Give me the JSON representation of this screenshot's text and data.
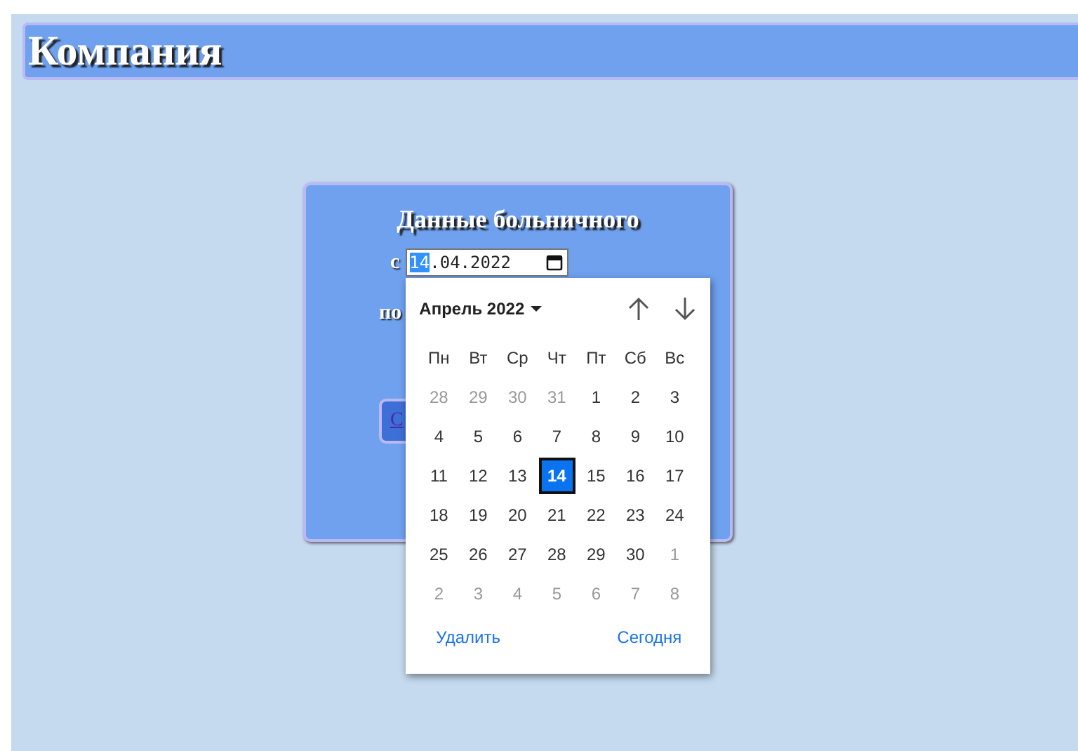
{
  "header": {
    "title": "Компания"
  },
  "form": {
    "title": "Данные больничного",
    "from_label": "с",
    "to_label": "по",
    "from_value": [
      {
        "text": "14",
        "selected": true
      },
      {
        "text": ".04.2022",
        "selected": false
      }
    ],
    "button": "С"
  },
  "datepicker": {
    "month": "Апрель 2022",
    "weekdays": [
      "Пн",
      "Вт",
      "Ср",
      "Чт",
      "Пт",
      "Сб",
      "Вс"
    ],
    "days": [
      {
        "text": "28",
        "muted": true,
        "selected": false
      },
      {
        "text": "29",
        "muted": true,
        "selected": false
      },
      {
        "text": "30",
        "muted": true,
        "selected": false
      },
      {
        "text": "31",
        "muted": true,
        "selected": false
      },
      {
        "text": "1",
        "muted": false,
        "selected": false
      },
      {
        "text": "2",
        "muted": false,
        "selected": false
      },
      {
        "text": "3",
        "muted": false,
        "selected": false
      },
      {
        "text": "4",
        "muted": false,
        "selected": false
      },
      {
        "text": "5",
        "muted": false,
        "selected": false
      },
      {
        "text": "6",
        "muted": false,
        "selected": false
      },
      {
        "text": "7",
        "muted": false,
        "selected": false
      },
      {
        "text": "8",
        "muted": false,
        "selected": false
      },
      {
        "text": "9",
        "muted": false,
        "selected": false
      },
      {
        "text": "10",
        "muted": false,
        "selected": false
      },
      {
        "text": "11",
        "muted": false,
        "selected": false
      },
      {
        "text": "12",
        "muted": false,
        "selected": false
      },
      {
        "text": "13",
        "muted": false,
        "selected": false
      },
      {
        "text": "14",
        "muted": false,
        "selected": true
      },
      {
        "text": "15",
        "muted": false,
        "selected": false
      },
      {
        "text": "16",
        "muted": false,
        "selected": false
      },
      {
        "text": "17",
        "muted": false,
        "selected": false
      },
      {
        "text": "18",
        "muted": false,
        "selected": false
      },
      {
        "text": "19",
        "muted": false,
        "selected": false
      },
      {
        "text": "20",
        "muted": false,
        "selected": false
      },
      {
        "text": "21",
        "muted": false,
        "selected": false
      },
      {
        "text": "22",
        "muted": false,
        "selected": false
      },
      {
        "text": "23",
        "muted": false,
        "selected": false
      },
      {
        "text": "24",
        "muted": false,
        "selected": false
      },
      {
        "text": "25",
        "muted": false,
        "selected": false
      },
      {
        "text": "26",
        "muted": false,
        "selected": false
      },
      {
        "text": "27",
        "muted": false,
        "selected": false
      },
      {
        "text": "28",
        "muted": false,
        "selected": false
      },
      {
        "text": "29",
        "muted": false,
        "selected": false
      },
      {
        "text": "30",
        "muted": false,
        "selected": false
      },
      {
        "text": "1",
        "muted": true,
        "selected": false
      },
      {
        "text": "2",
        "muted": true,
        "selected": false
      },
      {
        "text": "3",
        "muted": true,
        "selected": false
      },
      {
        "text": "4",
        "muted": true,
        "selected": false
      },
      {
        "text": "5",
        "muted": true,
        "selected": false
      },
      {
        "text": "6",
        "muted": true,
        "selected": false
      },
      {
        "text": "7",
        "muted": true,
        "selected": false
      },
      {
        "text": "8",
        "muted": true,
        "selected": false
      }
    ],
    "clear": "Удалить",
    "today": "Сегодня"
  }
}
